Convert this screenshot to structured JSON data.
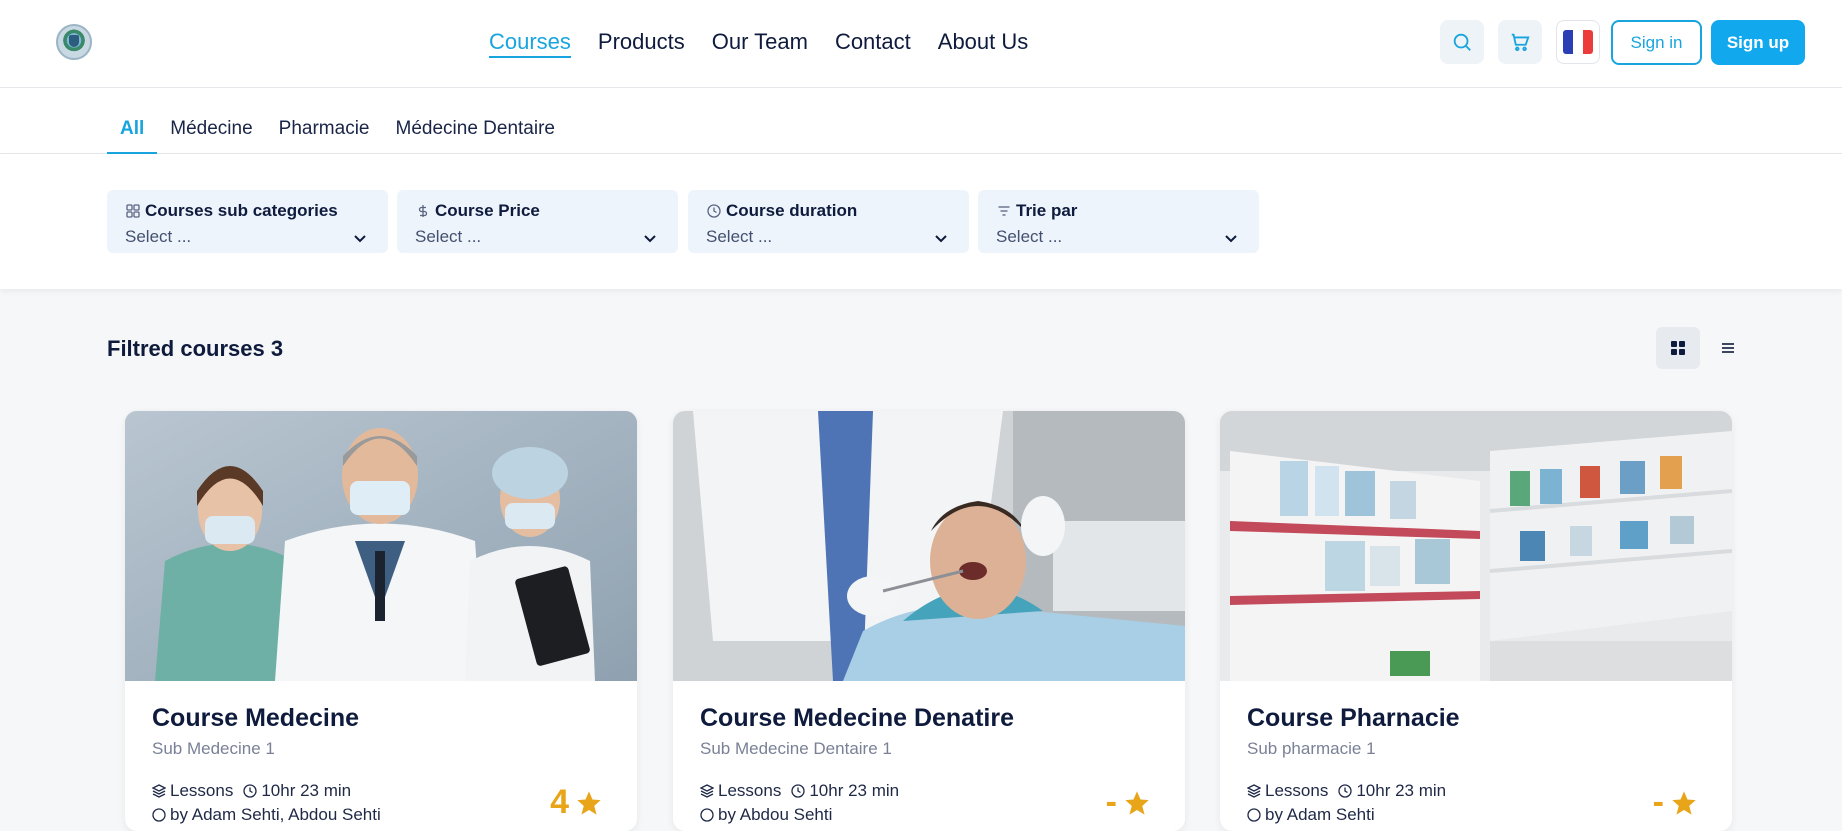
{
  "header": {
    "nav": [
      {
        "label": "Courses",
        "active": true
      },
      {
        "label": "Products",
        "active": false
      },
      {
        "label": "Our Team",
        "active": false
      },
      {
        "label": "Contact",
        "active": false
      },
      {
        "label": "About Us",
        "active": false
      }
    ],
    "signin_label": "Sign in",
    "signup_label": "Sign up",
    "language_flag": "fr"
  },
  "category_tabs": [
    {
      "label": "All",
      "active": true
    },
    {
      "label": "Médecine",
      "active": false
    },
    {
      "label": "Pharmacie",
      "active": false
    },
    {
      "label": "Médecine Dentaire",
      "active": false
    }
  ],
  "filters": [
    {
      "label": "Courses sub categories",
      "value": "Select ...",
      "icon": "grid-icon"
    },
    {
      "label": "Course Price",
      "value": "Select ...",
      "icon": "dollar-icon"
    },
    {
      "label": "Course duration",
      "value": "Select ...",
      "icon": "clock-icon"
    },
    {
      "label": "Trie par",
      "value": "Select ...",
      "icon": "filter-icon"
    }
  ],
  "results": {
    "title": "Filtred courses 3",
    "view_mode": "grid"
  },
  "courses": [
    {
      "title": "Course Medecine",
      "subcategory": "Sub Medecine 1",
      "lessons": "Lessons",
      "duration": "10hr 23 min",
      "author": "by Adam Sehti, Abdou Sehti",
      "rating": "4",
      "image": "medical-team"
    },
    {
      "title": "Course Medecine Denatire",
      "subcategory": "Sub Medecine Dentaire 1",
      "lessons": "Lessons",
      "duration": "10hr 23 min",
      "author": "by Abdou Sehti",
      "rating": "-",
      "image": "dentist"
    },
    {
      "title": "Course Pharnacie",
      "subcategory": "Sub pharmacie 1",
      "lessons": "Lessons",
      "duration": "10hr 23 min",
      "author": "by Adam Sehti",
      "rating": "-",
      "image": "pharmacy-shelves"
    }
  ],
  "colors": {
    "accent": "#18a5df",
    "primary_button": "#12a8ee",
    "rating": "#e8a51a",
    "filter_bg": "#edf4fc"
  }
}
